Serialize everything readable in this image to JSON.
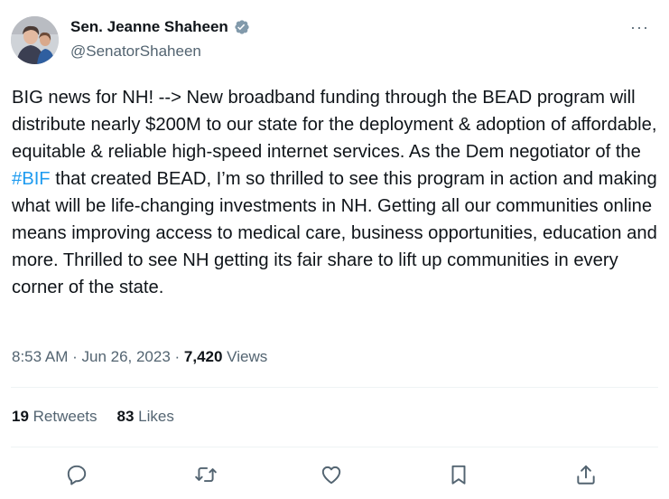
{
  "author": {
    "display_name": "Sen. Jeanne Shaheen",
    "handle": "@SenatorShaheen"
  },
  "more_label": "···",
  "tweet": {
    "text_before": "BIG news for NH! --> New broadband funding through the BEAD program will distribute nearly $200M to our state for the deployment & adoption of affordable, equitable & reliable high-speed internet services. As the Dem negotiator of the ",
    "hashtag": "#BIF",
    "text_after": " that created BEAD, I’m so thrilled to see this program in action and making what will be life-changing investments in NH. Getting all our communities online means improving access to medical care, business opportunities, education and more. Thrilled to see NH getting its fair share to lift up communities in every corner of the state."
  },
  "meta": {
    "time": "8:53 AM",
    "sep1": " · ",
    "date": "Jun 26, 2023",
    "sep2": " · ",
    "views_count": "7,420",
    "views_label": " Views"
  },
  "stats": {
    "retweets_count": "19",
    "retweets_label": " Retweets",
    "likes_count": "83",
    "likes_label": " Likes"
  },
  "colors": {
    "text": "#0f1419",
    "secondary": "#536471",
    "accent": "#1d9bf0",
    "divider": "#eff3f4"
  },
  "icons": [
    "reply-icon",
    "retweet-icon",
    "like-icon",
    "bookmark-icon",
    "share-icon",
    "verified-badge-icon"
  ]
}
